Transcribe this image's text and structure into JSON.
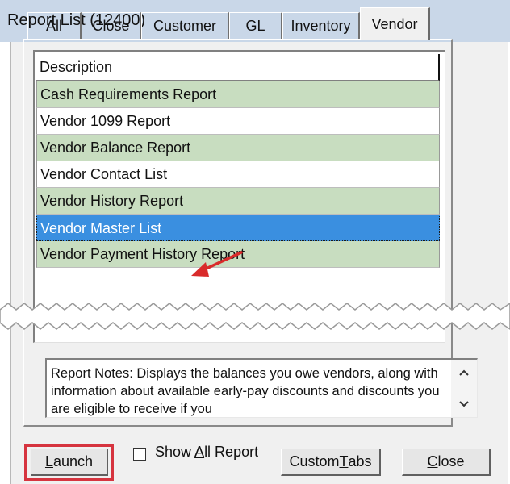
{
  "window": {
    "title": "Report List (12400)"
  },
  "tabs": [
    {
      "label": "All",
      "active": false
    },
    {
      "label": "Close",
      "active": false
    },
    {
      "label": "Customer",
      "active": false
    },
    {
      "label": "GL",
      "active": false
    },
    {
      "label": "Inventory",
      "active": false
    },
    {
      "label": "Vendor",
      "active": true
    }
  ],
  "report_list": {
    "header": "Description",
    "rows": [
      {
        "label": "Cash Requirements Report",
        "style": "green"
      },
      {
        "label": "Vendor 1099 Report",
        "style": "white"
      },
      {
        "label": "Vendor Balance Report",
        "style": "green"
      },
      {
        "label": "Vendor Contact List",
        "style": "white"
      },
      {
        "label": "Vendor History Report",
        "style": "green"
      },
      {
        "label": "Vendor Master List",
        "style": "selected"
      },
      {
        "label": "Vendor Payment History Report",
        "style": "green"
      }
    ]
  },
  "notes": {
    "text": "Report Notes:  Displays the balances you owe vendors, along with information about available early-pay discounts and discounts you are eligible to receive if you"
  },
  "buttons": {
    "launch": {
      "pre": "",
      "u": "L",
      "post": "aunch"
    },
    "custom_tabs": {
      "pre": "Custom ",
      "u": "T",
      "post": "abs"
    },
    "close": {
      "pre": "",
      "u": "C",
      "post": "lose"
    }
  },
  "show_all": {
    "pre": "Show ",
    "u": "A",
    "post": "ll Report",
    "checked": false
  },
  "colors": {
    "accent_outline": "#d6343f",
    "selection": "#3a8fe0",
    "row_green": "#c8ddc0",
    "arrow": "#d92b2b"
  }
}
